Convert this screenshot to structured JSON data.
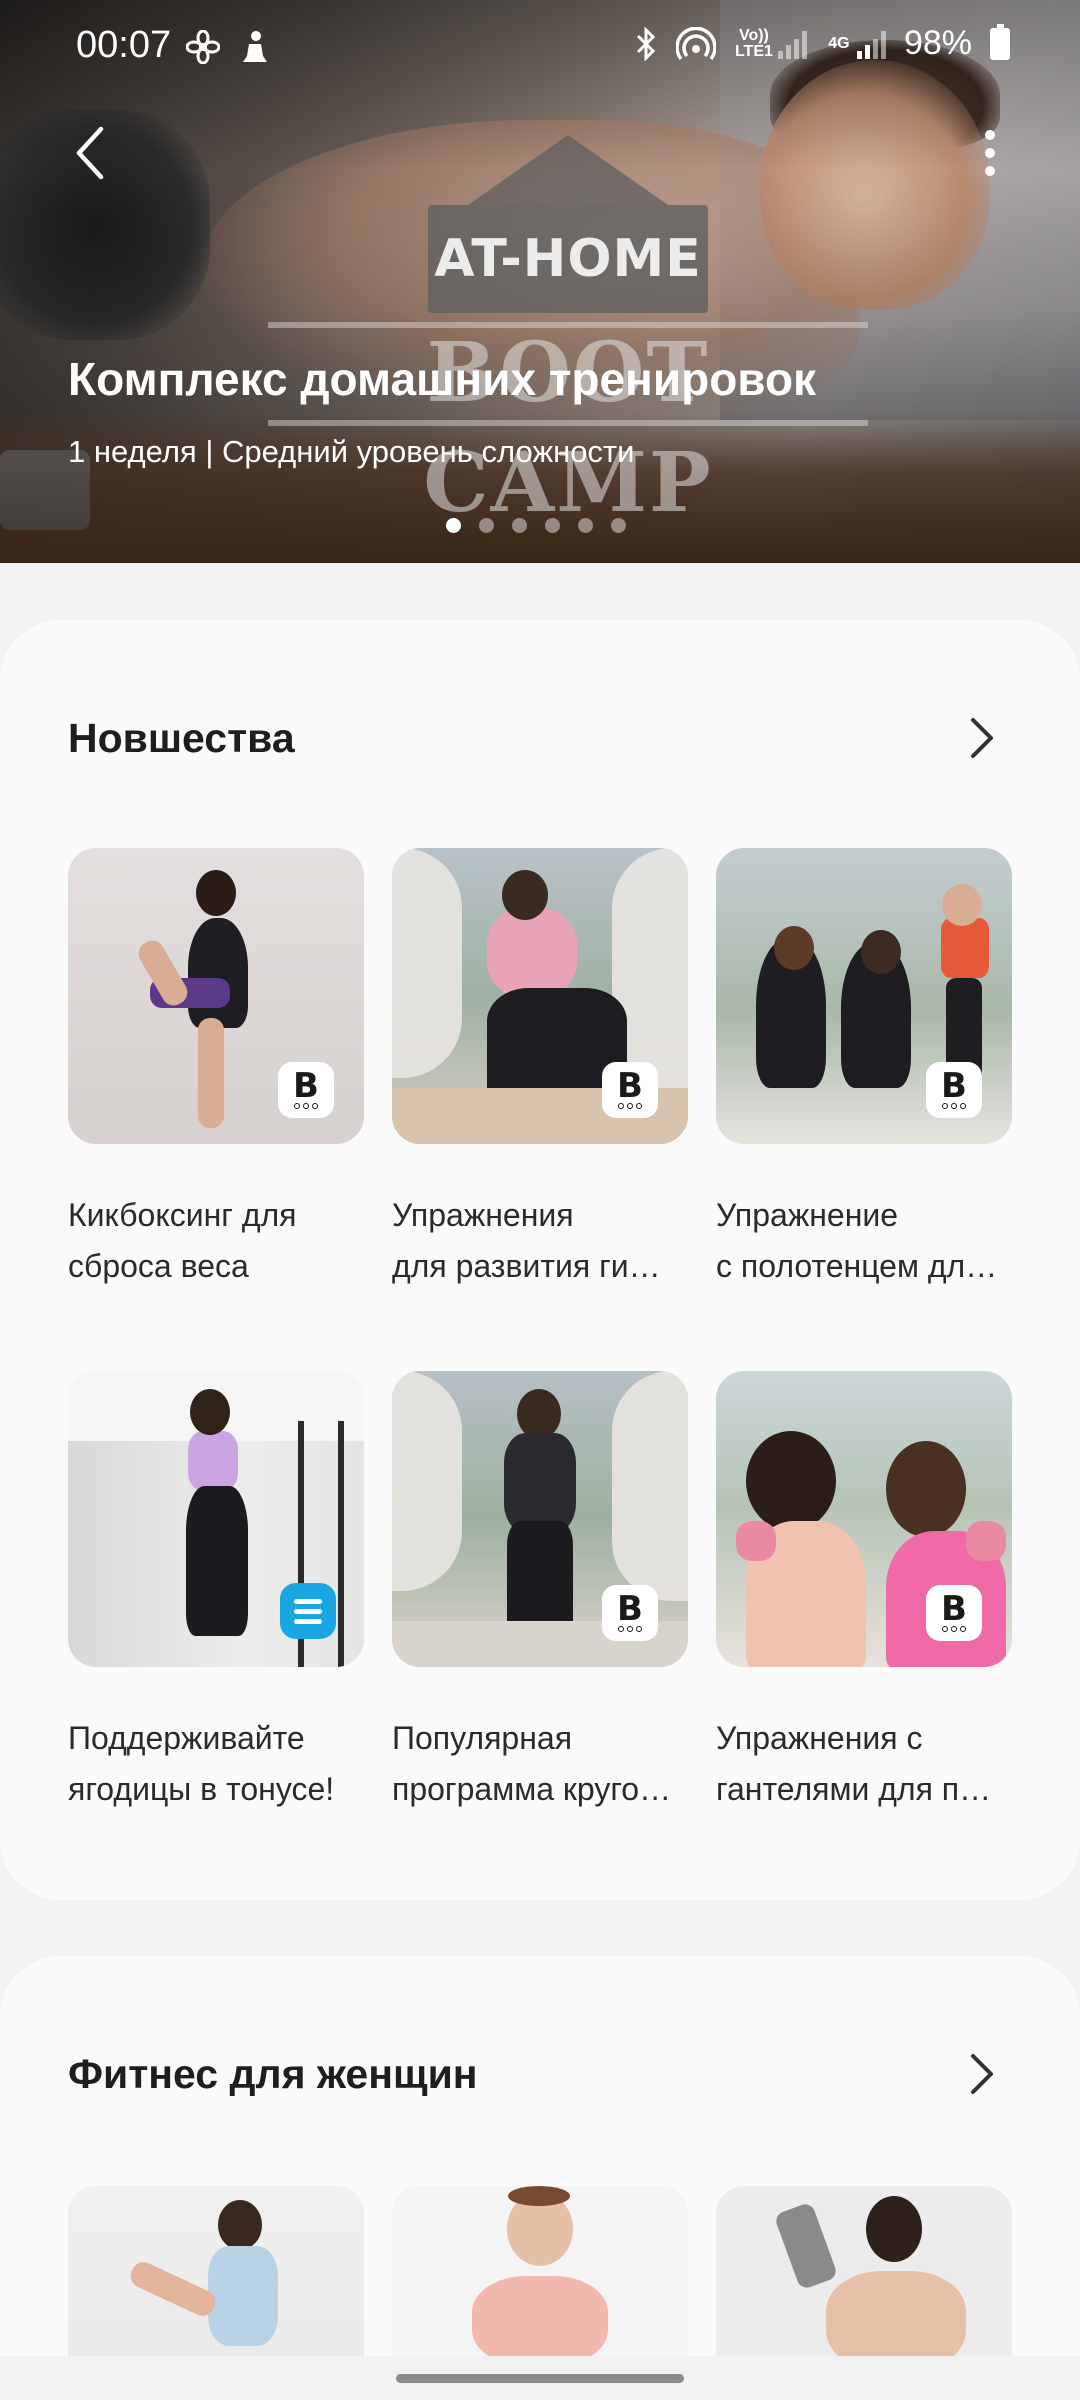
{
  "status_bar": {
    "time": "00:07",
    "left_icons": [
      "fan-icon",
      "person-icon"
    ],
    "network_label_1": "Vo)) LTE1",
    "network_label_2": "4G",
    "battery": "98%"
  },
  "hero": {
    "logo_top": "AT-HOME",
    "logo_bottom": "BOOT CAMP",
    "title": "Комплекс домашних тренировок",
    "subtitle": "1 неделя | Средний уровень сложности",
    "page_count": 6,
    "active_page": 0
  },
  "section_new": {
    "title": "Новшества",
    "items": [
      {
        "line1": "Кикбоксинг для",
        "line2": "сброса веса",
        "badge": "B"
      },
      {
        "line1": "Упражнения",
        "line2": "для развития ги…",
        "badge": "B"
      },
      {
        "line1": "Упражнение",
        "line2": "с полотенцем дл…",
        "badge": "B"
      },
      {
        "line1": "Поддерживайте",
        "line2": "ягодицы в тонусе!",
        "badge": "blue"
      },
      {
        "line1": "Популярная",
        "line2": "программа круго…",
        "badge": "B"
      },
      {
        "line1": "Упражнения с",
        "line2": "гантелями для п…",
        "badge": "B"
      }
    ]
  },
  "section_women": {
    "title": "Фитнес для женщин"
  },
  "colors": {
    "background": "#f2f2f2",
    "card": "#fafafa",
    "badge_blue": "#1aa6e3"
  }
}
